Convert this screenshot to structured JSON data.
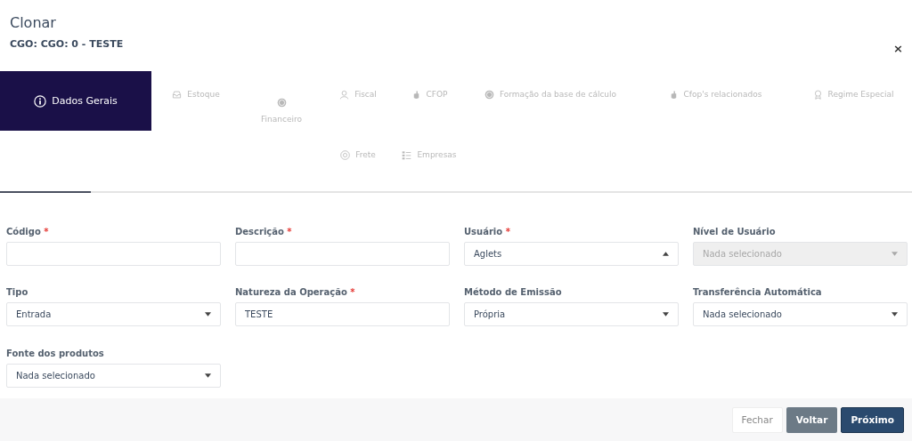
{
  "header": {
    "title": "Clonar",
    "subtitle": "CGO: CGO: 0 - TESTE",
    "close": "×"
  },
  "tabs": [
    {
      "label": "Dados Gerais",
      "selected": true
    },
    {
      "label": "Estoque",
      "selected": false
    },
    {
      "label": "Financeiro",
      "selected": false
    },
    {
      "label": "Fiscal",
      "selected": false
    },
    {
      "label": "CFOP",
      "selected": false
    },
    {
      "label": "Formação da base de cálculo",
      "selected": false
    },
    {
      "label": "Cfop's relacionados",
      "selected": false
    },
    {
      "label": "Regime Especial",
      "selected": false
    },
    {
      "label": "Frete",
      "selected": false
    },
    {
      "label": "Empresas",
      "selected": false
    }
  ],
  "fields": [
    {
      "label": "Código",
      "required": true,
      "kind": "text",
      "disabled": false
    },
    {
      "label": "Descrição",
      "required": true,
      "kind": "text",
      "disabled": false
    },
    {
      "label": "Usuário",
      "required": true,
      "kind": "select",
      "value": "Aglets",
      "expanded": true,
      "disabled": false
    },
    {
      "label": "Nível de Usuário",
      "required": false,
      "kind": "select",
      "value": "Nada selecionado",
      "expanded": false,
      "disabled": true
    },
    {
      "label": "Tipo",
      "required": false,
      "kind": "select",
      "value": "Entrada",
      "expanded": false,
      "disabled": false
    },
    {
      "label": "Natureza da Operação",
      "required": true,
      "kind": "text",
      "value": "TESTE",
      "disabled": false
    },
    {
      "label": "Método de Emissão",
      "required": false,
      "kind": "select",
      "value": "Própria",
      "expanded": false,
      "disabled": false
    },
    {
      "label": "Transferência Automática",
      "required": false,
      "kind": "select",
      "value": "Nada selecionado",
      "expanded": false,
      "disabled": false
    },
    {
      "label": "Fonte dos produtos",
      "required": false,
      "kind": "select",
      "value": "Nada selecionado",
      "expanded": false,
      "disabled": false
    }
  ],
  "required_mark": "*",
  "buttons": [
    {
      "label": "Fechar",
      "kind": "default"
    },
    {
      "label": "Voltar",
      "kind": "secondary"
    },
    {
      "label": "Próximo",
      "kind": "primary"
    }
  ]
}
